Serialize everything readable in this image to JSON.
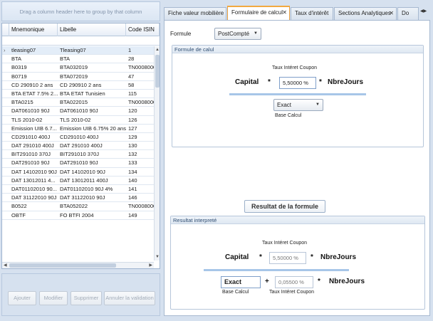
{
  "grid": {
    "group_hint": "Drag a column header here to group by that column",
    "columns": [
      "Mnemonique",
      "Libelle",
      "Code ISIN"
    ],
    "rows": [
      [
        "tleasing07",
        "Tleasing07",
        "1"
      ],
      [
        "BTA",
        "BTA",
        "28"
      ],
      [
        "B0319",
        "BTA032019",
        "TN0008000"
      ],
      [
        "B0719",
        "BTA072019",
        "47"
      ],
      [
        "CD 290910 2 ans",
        "CD 290910 2 ans",
        "58"
      ],
      [
        "BTA ETAT 7.5% 2...",
        "BTA ETAT Tunisien",
        "115"
      ],
      [
        "BTA0215",
        "BTA022015",
        "TN0008000"
      ],
      [
        "DAT061010 90J",
        "DAT061010 90J",
        "120"
      ],
      [
        "TLS 2010-02",
        "TLS 2010-02",
        "126"
      ],
      [
        "Emission UIB 6.7...",
        "Emission UIB 6.75% 20 ans",
        "127"
      ],
      [
        "CD291010 400J",
        "CD291010 400J",
        "129"
      ],
      [
        "DAT 291010 400J",
        "DAT 291010 400J",
        "130"
      ],
      [
        "BIT291010 370J",
        "BIT291010 370J",
        "132"
      ],
      [
        "DAT291010 90J",
        "DAT291010 90J",
        "133"
      ],
      [
        "DAT 14102010 90J",
        "DAT 14102010 90J",
        "134"
      ],
      [
        "DAT 13012011 4...",
        "DAT 13012011 400J",
        "140"
      ],
      [
        "DAT01102010 90...",
        "DAT01102010 90J 4%",
        "141"
      ],
      [
        "DAT 31122010 90J",
        "DAT 31122010 90J",
        "146"
      ],
      [
        "B0522",
        "BTA052022",
        "TN0008000"
      ],
      [
        "OBTF",
        "FO BTFI 2004",
        "149"
      ]
    ]
  },
  "actions": {
    "add": "Ajouter",
    "edit": "Modifier",
    "delete": "Supprimer",
    "cancel": "Annuler la validation"
  },
  "tabs": [
    "Fiche valeur mobilière",
    "Formulaire de calcul",
    "Taux d'intérêt",
    "Sections Analytiques",
    "Do"
  ],
  "form": {
    "formule_label": "Formule",
    "formule_value": "PostCompté",
    "group1_title": "Formule de calul",
    "taux_label": "Taux Intéret Coupon",
    "capital": "Capital",
    "nbrejours": "NbreJours",
    "star": "*",
    "taux_value": "5,50000 %",
    "base_value": "Exact",
    "base_label": "Base Calcul",
    "result_button": "Resultat de la formule",
    "group2_title": "Resultat interpreté",
    "plus": "+",
    "taux_small_value": "0,05500 %"
  },
  "colors": {
    "accent_tab": "#f2a940",
    "panel_bg": "#d6e1ef",
    "group_title": "#2f4d72"
  }
}
